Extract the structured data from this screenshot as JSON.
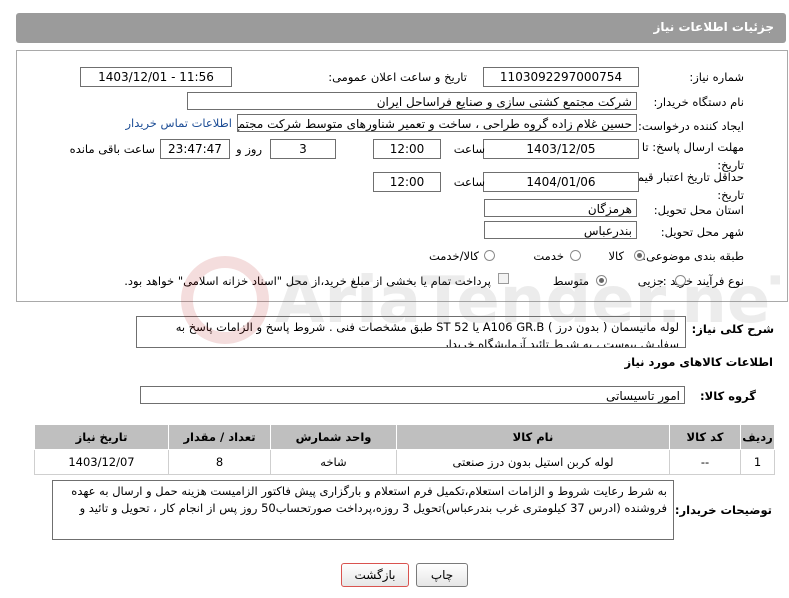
{
  "header": {
    "title": "جزئیات اطلاعات نیاز"
  },
  "fields": {
    "need_number_label": "شماره نیاز:",
    "need_number": "1103092297000754",
    "announce_label": "تاریخ و ساعت اعلان عمومی:",
    "announce_value": "1403/12/01 - 11:56",
    "buyer_org_label": "نام دستگاه خریدار:",
    "buyer_org": "شرکت مجتمع کشتی سازی و صنایع فراساحل ایران",
    "requester_label": "ایجاد کننده درخواست:",
    "requester": "حسین  غلام زاده گروه طراحی ، ساخت و تعمیر شناورهای متوسط شرکت مجتمع",
    "contact_link": "اطلاعات تماس خریدار",
    "deadline_label": "مهلت ارسال پاسخ: تا تاریخ:",
    "deadline_date": "1403/12/05",
    "time_label": "ساعت",
    "deadline_time": "12:00",
    "days_value": "3",
    "days_label": "روز و",
    "remaining_time": "23:47:47",
    "remaining_label": "ساعت باقی مانده",
    "price_validity_label": "حداقل تاریخ اعتبار قیمت: تا تاریخ:",
    "price_validity_date": "1404/01/06",
    "price_validity_time": "12:00",
    "province_label": "استان محل تحویل:",
    "province": "هرمزگان",
    "city_label": "شهر محل تحویل:",
    "city": "بندرعباس",
    "category_label": "طبقه بندی موضوعی:",
    "category_options": [
      "کالا",
      "خدمت",
      "کالا/خدمت"
    ],
    "process_label": "نوع فرآیند خرید :",
    "process_options": [
      "جزیی",
      "متوسط"
    ],
    "payment_text": "پرداخت تمام یا بخشی از مبلغ خرید،از محل \"اسناد خزانه اسلامی\" خواهد بود."
  },
  "summary": {
    "label": "شرح کلی نیاز:",
    "text": "لوله مانیسمان ( بدون درز )  A106 GR.B یا ST 52  طبق مشخصات فنی . شروط پاسخ و الزامات پاسخ به سفارش پیوست ، به شرط تائید آزمایشگاه خریدار"
  },
  "goods_section": {
    "title": "اطلاعات کالاهای مورد نیاز",
    "group_label": "گروه کالا:",
    "group_value": "امور تاسیساتی"
  },
  "table": {
    "headers": [
      "ردیف",
      "کد کالا",
      "نام کالا",
      "واحد شمارش",
      "تعداد / مقدار",
      "تاریخ نیاز"
    ],
    "rows": [
      [
        "1",
        "--",
        "لوله کربن استیل بدون درز صنعتی",
        "شاخه",
        "8",
        "1403/12/07"
      ]
    ]
  },
  "buyer_notes": {
    "label": "توضیحات خریدار:",
    "text": "به شرط رعایت شروط و الزامات استعلام،تکمیل فرم استعلام و بارگزاری پیش فاکتور  الزامیست هزینه حمل و ارسال  به عهده فروشنده (ادرس 37 کیلومتری غرب بندرعباس)تحویل 3 روزه،پرداخت صورتحساب50 روز پس از انجام کار ،  تحویل و تائید و"
  },
  "buttons": {
    "print": "چاپ",
    "back": "بازگشت"
  },
  "watermark": {
    "text": "AriaTender.neT"
  },
  "colors": {
    "header_bg": "#9b9b9b",
    "link": "#1e4e96",
    "table_header": "#bfbfbf",
    "back_button_border": "#d9534f"
  }
}
